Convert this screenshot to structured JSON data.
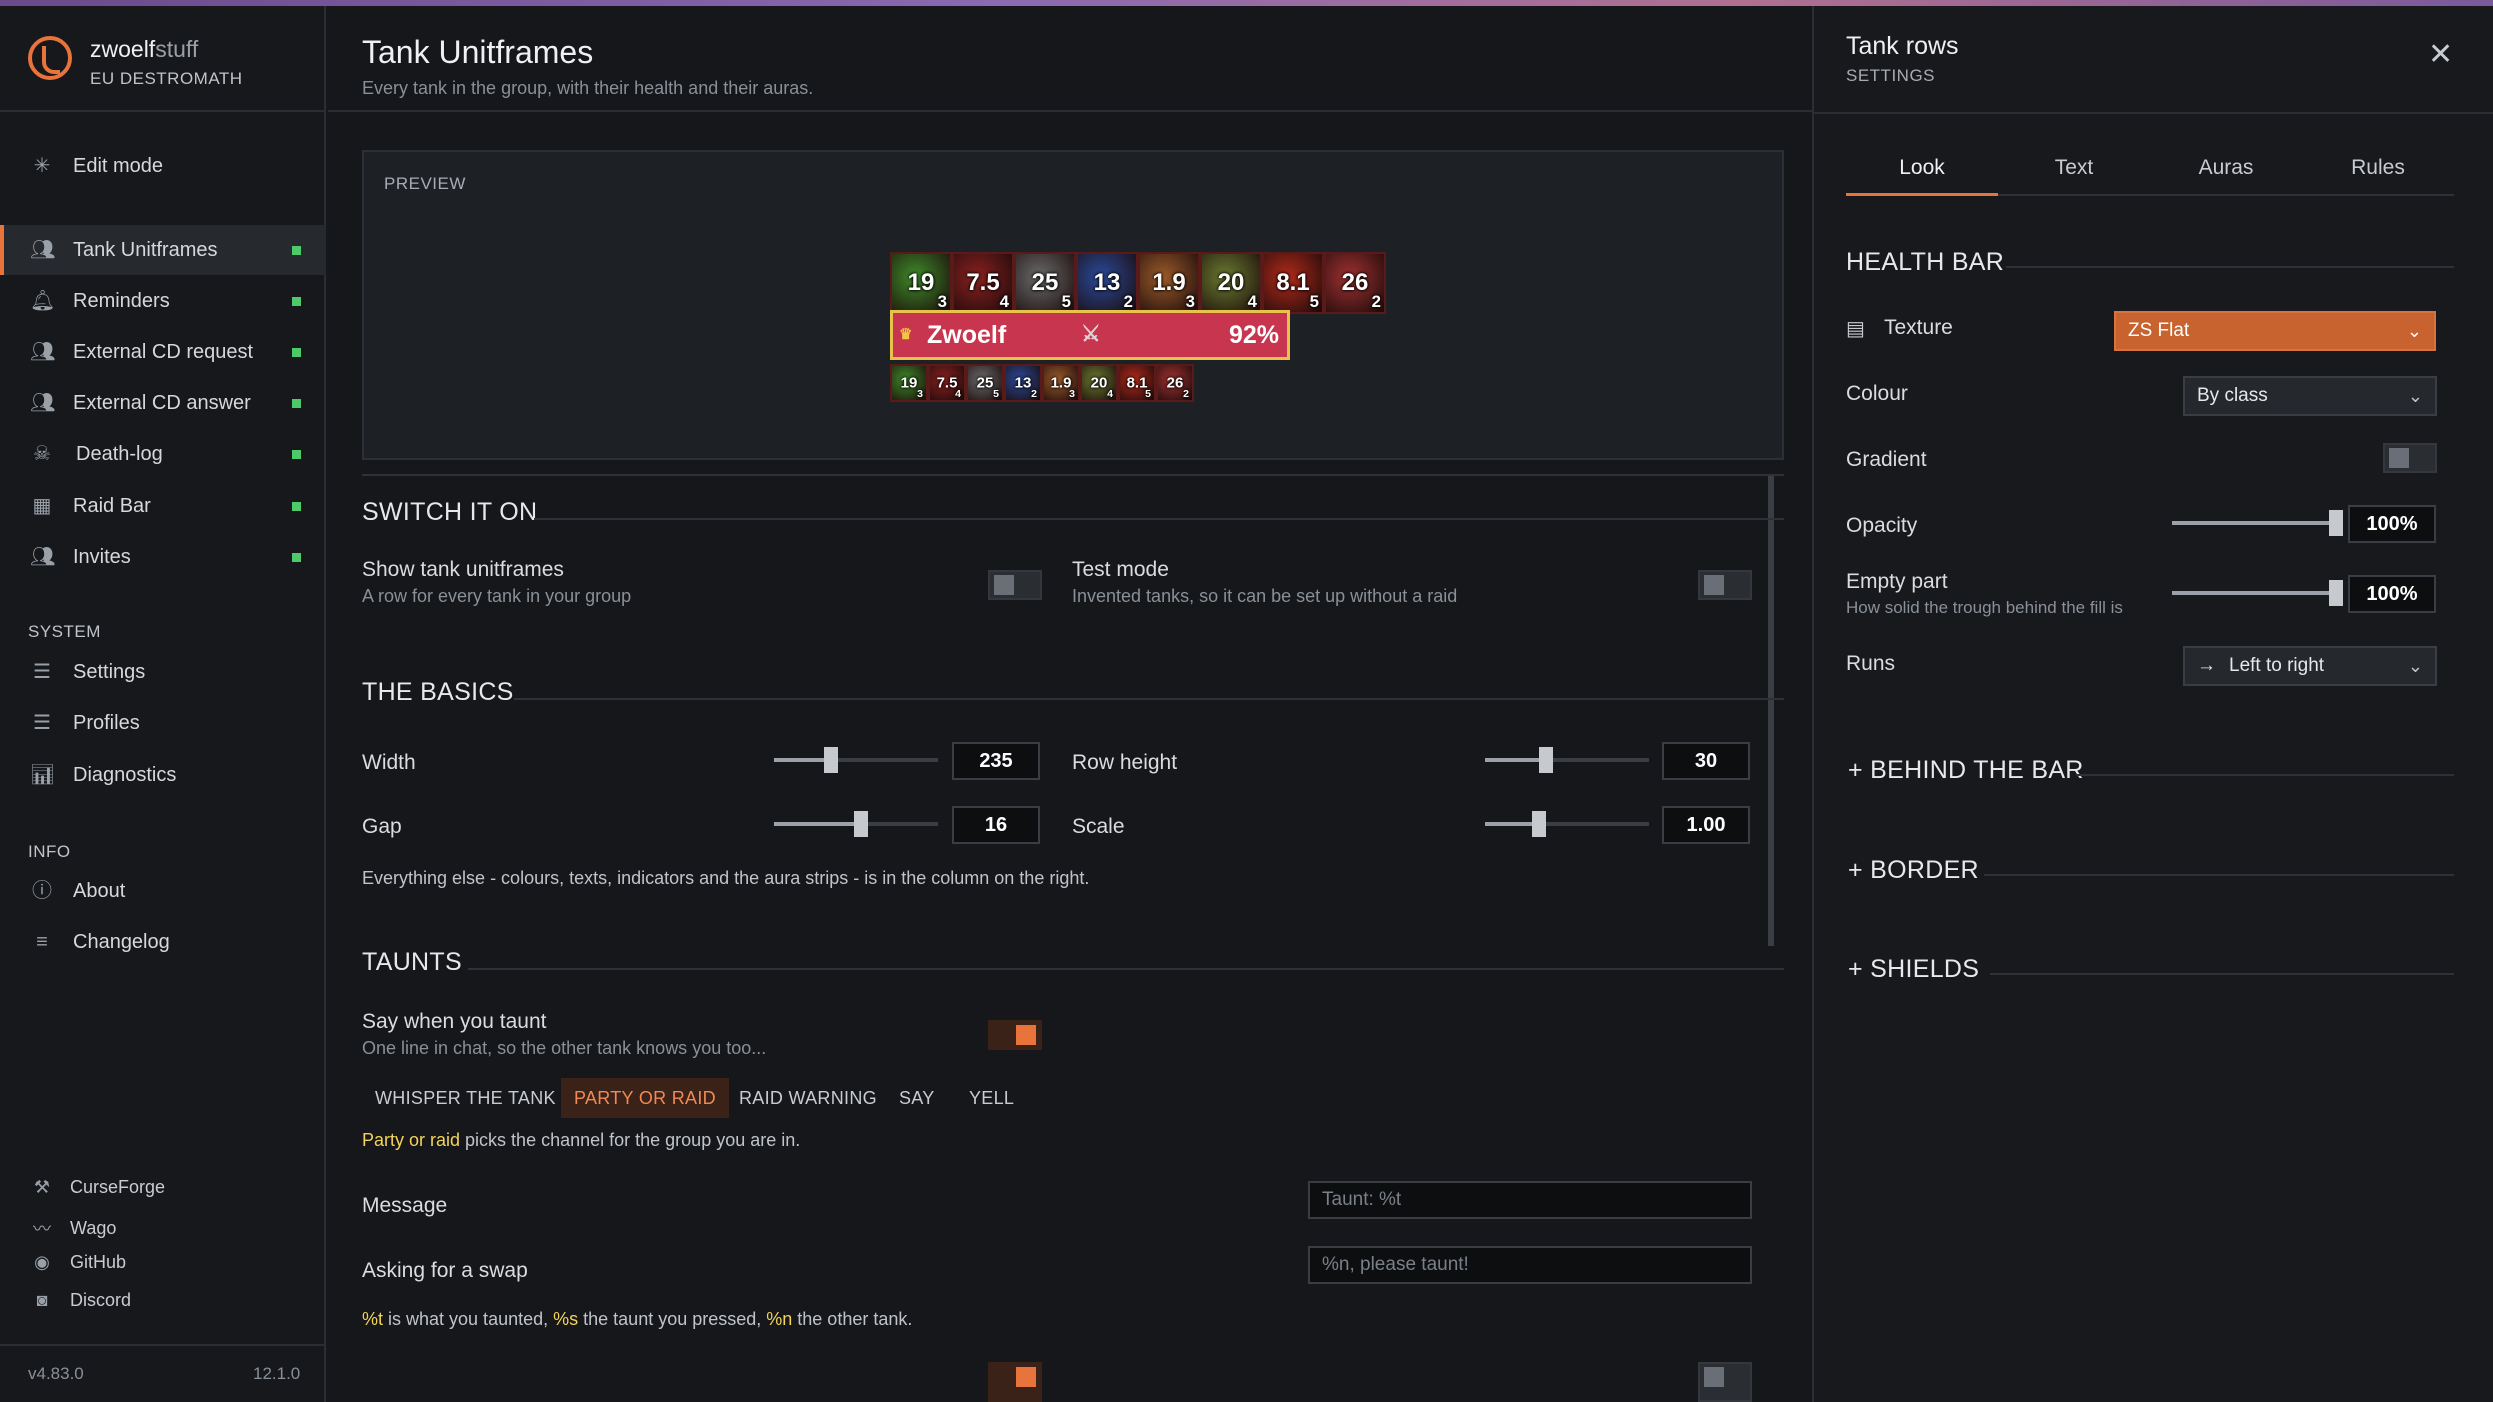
{
  "brand": {
    "name_a": "zwoelf",
    "name_b": "stuff",
    "realm": "EU DESTROMATH"
  },
  "sidebar": {
    "edit_mode": "Edit mode",
    "items": [
      {
        "label": "Tank Unitframes",
        "status_color": "#4ec96a"
      },
      {
        "label": "Reminders",
        "status_color": "#4ec96a"
      },
      {
        "label": "External CD request",
        "status_color": "#4ec96a"
      },
      {
        "label": "External CD answer",
        "status_color": "#4ec96a"
      },
      {
        "label": "Death-log",
        "status_color": "#4ec96a"
      },
      {
        "label": "Raid Bar",
        "status_color": "#4ec96a"
      },
      {
        "label": "Invites",
        "status_color": "#4ec96a"
      }
    ],
    "system_head": "SYSTEM",
    "system": [
      "Settings",
      "Profiles",
      "Diagnostics"
    ],
    "info_head": "INFO",
    "info": [
      "About",
      "Changelog"
    ],
    "links": [
      "CurseForge",
      "Wago",
      "GitHub",
      "Discord"
    ],
    "version": "v4.83.0",
    "game_version": "12.1.0"
  },
  "page": {
    "title": "Tank Unitframes",
    "subtitle": "Every tank in the group, with their health and their auras."
  },
  "preview": {
    "label": "PREVIEW",
    "auras": [
      {
        "n": "19",
        "s": "3",
        "c": "#3f8a2a"
      },
      {
        "n": "7.5",
        "s": "4",
        "c": "#8a2020"
      },
      {
        "n": "25",
        "s": "5",
        "c": "#6a6a6a"
      },
      {
        "n": "13",
        "s": "2",
        "c": "#2a4a9a"
      },
      {
        "n": "1.9",
        "s": "3",
        "c": "#9a5a2a"
      },
      {
        "n": "20",
        "s": "4",
        "c": "#6a7a30"
      },
      {
        "n": "8.1",
        "s": "5",
        "c": "#b02a1a"
      },
      {
        "n": "26",
        "s": "2",
        "c": "#a03030"
      }
    ],
    "unit": {
      "name": "Zwoelf",
      "health": "92%"
    }
  },
  "switch": {
    "heading": "SWITCH IT ON",
    "show_label": "Show tank unitframes",
    "show_sub": "A row for every tank in your group",
    "test_label": "Test mode",
    "test_sub": "Invented tanks, so it can be set up without a raid"
  },
  "basics": {
    "heading": "THE BASICS",
    "width_label": "Width",
    "width": "235",
    "width_frac": 0.35,
    "row_height_label": "Row height",
    "row_height": "30",
    "row_height_frac": 0.37,
    "gap_label": "Gap",
    "gap": "16",
    "gap_frac": 0.53,
    "scale_label": "Scale",
    "scale": "1.00",
    "scale_frac": 0.33,
    "note": "Everything else - colours, texts, indicators and the aura strips - is in the column on the right."
  },
  "taunts": {
    "heading": "TAUNTS",
    "say_label": "Say when you taunt",
    "say_sub": "One line in chat, so the other tank knows you too...",
    "channels": [
      "WHISPER THE TANK",
      "PARTY OR RAID",
      "RAID WARNING",
      "SAY",
      "YELL"
    ],
    "channel_hl": "Party or raid",
    "channel_note": " picks the channel for the group you are in.",
    "message_label": "Message",
    "message_placeholder": "Taunt: %t",
    "swap_label": "Asking for a swap",
    "swap_placeholder": "%n, please taunt!",
    "tok_t": "%t",
    "tok_t_desc": " is what you taunted, ",
    "tok_s": "%s",
    "tok_s_desc": " the taunt you pressed, ",
    "tok_n": "%n",
    "tok_n_desc": " the other tank."
  },
  "panel": {
    "title": "Tank rows",
    "subtitle": "SETTINGS",
    "tabs": [
      "Look",
      "Text",
      "Auras",
      "Rules"
    ],
    "health_bar": "HEALTH BAR",
    "texture_label": "Texture",
    "texture": "ZS Flat",
    "colour_label": "Colour",
    "colour": "By class",
    "gradient_label": "Gradient",
    "opacity_label": "Opacity",
    "opacity": "100%",
    "opacity_frac": 1.0,
    "empty_label": "Empty part",
    "empty_sub": "How solid the trough behind the fill is",
    "empty": "100%",
    "empty_frac": 1.0,
    "runs_label": "Runs",
    "runs": "Left to right",
    "behind": "+ BEHIND THE BAR",
    "border": "+ BORDER",
    "shields": "+ SHIELDS"
  }
}
